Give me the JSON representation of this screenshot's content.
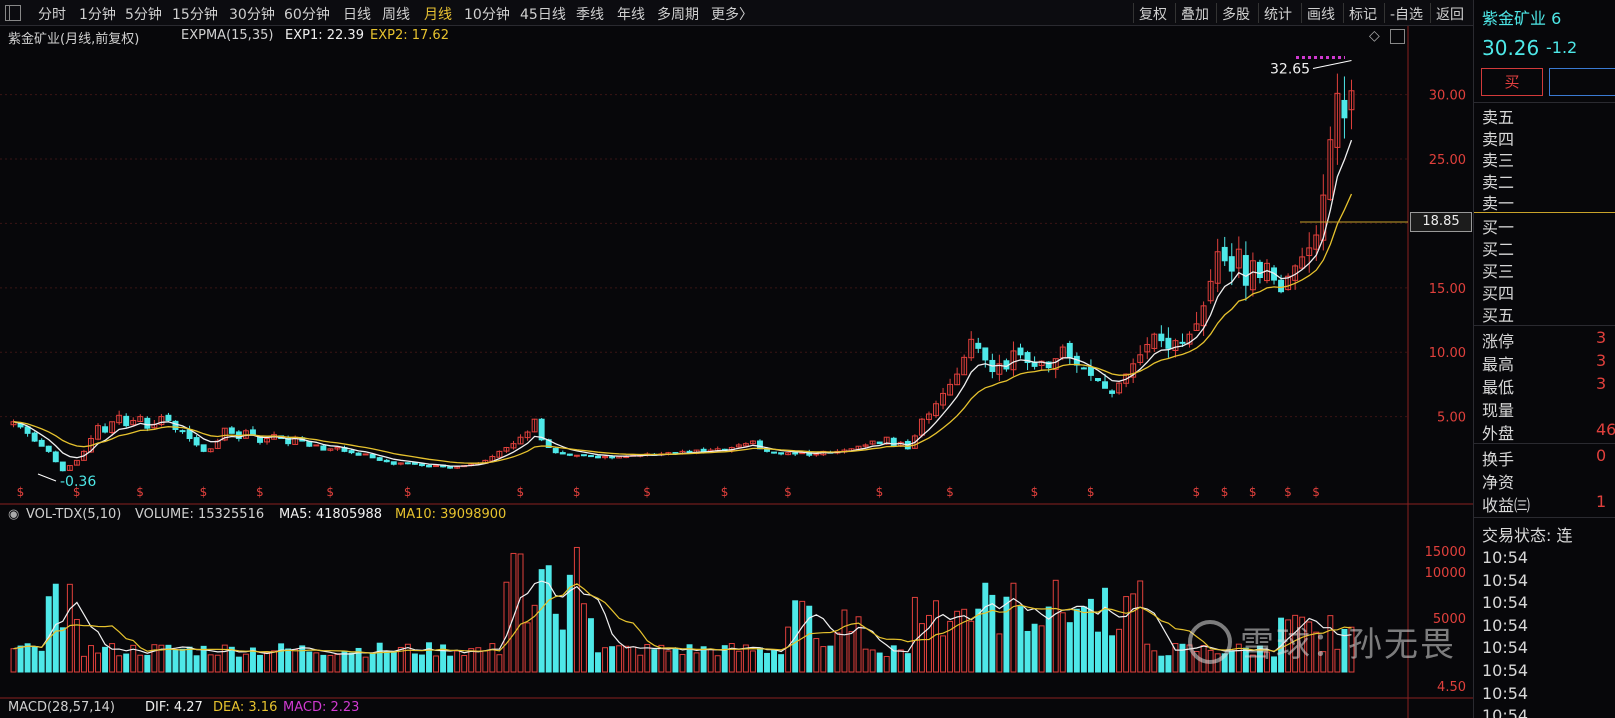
{
  "toolbar": {
    "periods": [
      "分时",
      "1分钟",
      "5分钟",
      "15分钟",
      "30分钟",
      "60分钟",
      "日线",
      "周线",
      "月线",
      "10分钟",
      "45日线",
      "季线",
      "年线",
      "多周期",
      "更多〉"
    ],
    "active_period": "月线",
    "right_buttons": [
      "复权",
      "叠加",
      "多股",
      "统计",
      "画线",
      "标记",
      "-自选",
      "返回"
    ]
  },
  "main_header": {
    "title": "紫金矿业(月线,前复权)",
    "indicator": "EXPMA(15,35)",
    "exp1": "EXP1: 22.39",
    "exp2": "EXP2: 17.62"
  },
  "vol_header": {
    "name": "VOL-TDX(5,10)",
    "volume": "VOLUME: 15325516",
    "ma5": "MA5: 41805988",
    "ma10": "MA10: 39098900"
  },
  "macd_header": {
    "name": "MACD(28,57,14)",
    "dif": "DIF: 4.27",
    "dea": "DEA: 3.16",
    "macd": "MACD: 2.23"
  },
  "price_axis": [
    "30.00",
    "25.00",
    "20.00",
    "15.00",
    "10.00",
    "5.00"
  ],
  "vol_axis": [
    "15000",
    "10000",
    "5000"
  ],
  "macd_axis": [
    "4.50"
  ],
  "current_price_tag": "18.85",
  "annotations": {
    "high": "32.65",
    "low": "-0.36"
  },
  "side_panel": {
    "stock_name": "紫金矿业 6",
    "price": "30.26",
    "change": "-1.2",
    "buy_label": "买",
    "sell_levels": [
      "卖五",
      "卖四",
      "卖三",
      "卖二",
      "卖一"
    ],
    "buy_levels": [
      "买一",
      "买二",
      "买三",
      "买四",
      "买五"
    ],
    "stats": [
      "涨停",
      "最高",
      "最低",
      "现量",
      "外盘"
    ],
    "stats_values": [
      "3",
      "3",
      "3",
      "",
      "46"
    ],
    "stats2": [
      "换手",
      "净资",
      "收益㈢"
    ],
    "stats2_values": [
      "0",
      "",
      "1"
    ],
    "trade_status": "交易状态: 连",
    "ticks": [
      "10:54",
      "10:54",
      "10:54",
      "10:54",
      "10:54",
      "10:54",
      "10:54",
      "10:54"
    ]
  },
  "watermark": "雪球：孙无畏",
  "colors": {
    "up": "#e0403c",
    "down": "#4ee8e8",
    "exp1": "#f0f0f0",
    "exp2": "#e6c22e",
    "ma10": "#e6c22e",
    "macd": "#d03ad0"
  },
  "chart_data": {
    "type": "candlestick",
    "ylim": [
      0,
      33
    ],
    "yticks": [
      5,
      10,
      15,
      20,
      25,
      30
    ],
    "close_series": [
      4.6,
      4.2,
      3.7,
      3.1,
      2.7,
      2.3,
      1.5,
      0.8,
      1.2,
      1.6,
      2.3,
      3.3,
      4.3,
      3.8,
      4.6,
      5.1,
      4.3,
      4.7,
      5.0,
      4.1,
      4.4,
      5.0,
      4.7,
      4.0,
      3.9,
      3.3,
      2.8,
      2.3,
      2.5,
      3.1,
      4.1,
      3.7,
      3.3,
      3.9,
      3.6,
      3.0,
      3.3,
      3.6,
      3.3,
      2.9,
      3.4,
      3.1,
      2.7,
      2.8,
      2.4,
      2.5,
      2.6,
      2.3,
      2.2,
      2.0,
      2.1,
      1.8,
      1.6,
      1.5,
      1.3,
      1.4,
      1.4,
      1.3,
      1.2,
      1.1,
      1.2,
      1.1,
      1.0,
      1.1,
      1.2,
      1.3,
      1.4,
      1.6,
      1.9,
      2.3,
      2.6,
      2.9,
      3.4,
      3.8,
      4.8,
      3.2,
      2.6,
      2.2,
      2.1,
      2.0,
      2.0,
      2.0,
      1.9,
      1.8,
      1.9,
      1.8,
      1.9,
      1.9,
      2.0,
      2.0,
      2.1,
      2.0,
      2.1,
      2.2,
      2.1,
      2.3,
      2.2,
      2.4,
      2.3,
      2.4,
      2.5,
      2.4,
      2.6,
      2.8,
      2.9,
      3.1,
      2.5,
      2.3,
      2.2,
      2.1,
      2.2,
      2.1,
      2.2,
      2.0,
      2.1,
      2.3,
      2.2,
      2.3,
      2.4,
      2.5,
      2.7,
      2.8,
      3.1,
      2.9,
      3.4,
      2.7,
      3.0,
      2.5,
      3.5,
      4.8,
      5.2,
      6.0,
      6.8,
      7.5,
      8.3,
      9.6,
      11.0,
      10.3,
      9.4,
      8.5,
      9.1,
      8.7,
      10.1,
      9.8,
      9.2,
      8.9,
      9.3,
      8.8,
      9.5,
      10.4,
      9.6,
      9.0,
      8.7,
      8.2,
      7.8,
      7.2,
      6.8,
      7.6,
      8.3,
      9.1,
      9.8,
      10.6,
      11.4,
      10.9,
      10.3,
      10.9,
      10.7,
      11.4,
      12.2,
      13.6,
      15.5,
      17.8,
      17.1,
      16.3,
      18.0,
      15.2,
      17.1,
      15.8,
      16.9,
      15.6,
      14.7,
      15.9,
      16.7,
      17.4,
      18.1,
      19.1,
      22.2,
      26.5,
      30.1,
      28.2,
      30.3
    ]
  }
}
